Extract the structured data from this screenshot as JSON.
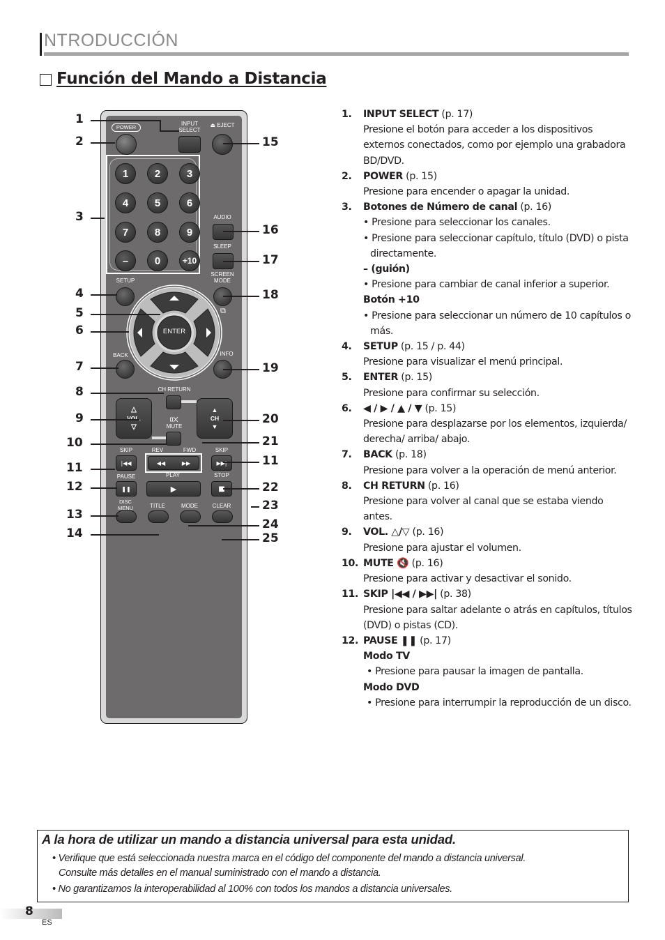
{
  "header": {
    "section": "NTRODUCCIÓN",
    "title": "Función del Mando a Distancia",
    "check_icon": "☑"
  },
  "remote": {
    "labels": {
      "power": "POWER",
      "input_select": "INPUT SELECT",
      "eject": "⏏ EJECT",
      "audio": "AUDIO",
      "sleep": "SLEEP",
      "screen_mode": "SCREEN MODE",
      "setup": "SETUP",
      "enter": "ENTER",
      "back": "BACK",
      "info": "INFO",
      "ch_return": "CH RETURN",
      "vol": "VOL.",
      "mute": "MUTE",
      "ch": "CH",
      "skip_prev": "SKIP",
      "rev": "REV",
      "fwd": "FWD",
      "skip_next": "SKIP",
      "pause": "PAUSE",
      "play": "PLAY",
      "stop": "STOP",
      "disc_menu": "DISC MENU",
      "title": "TITLE",
      "mode": "MODE",
      "clear": "CLEAR"
    },
    "numpad": [
      "1",
      "2",
      "3",
      "4",
      "5",
      "6",
      "7",
      "8",
      "9",
      "–",
      "0",
      "+10"
    ],
    "icons": {
      "up": "▲",
      "down": "▼",
      "left": "◀",
      "right": "▶",
      "vol_up": "△",
      "vol_down": "▽",
      "ch_up": "▲",
      "ch_down": "▼",
      "mute": "🔇",
      "skip_prev": "|◀◀",
      "rev": "◀◀",
      "fwd": "▶▶",
      "skip_next": "▶▶|",
      "pause": "❚❚",
      "play": "▶",
      "stop": "■",
      "screen_mode": "⧉"
    },
    "callouts_left": [
      "1",
      "2",
      "3",
      "4",
      "5",
      "6",
      "7",
      "8",
      "9",
      "10",
      "11",
      "12",
      "13",
      "14"
    ],
    "callouts_right": [
      "15",
      "16",
      "17",
      "18",
      "19",
      "20",
      "21",
      "11",
      "22",
      "23",
      "24",
      "25"
    ]
  },
  "items": [
    {
      "num": "1.",
      "name": "INPUT SELECT",
      "ref": " (p. 17)",
      "text": "Presione el botón para acceder a los dispositivos externos conectados, como por ejemplo una grabadora BD/DVD."
    },
    {
      "num": "2.",
      "name": "POWER",
      "ref": " (p. 15)",
      "text": "Presione para encender o apagar la unidad."
    },
    {
      "num": "3.",
      "name": "Botones de Número de canal",
      "ref": " (p. 16)",
      "bullets": [
        "• Presione para seleccionar los canales.",
        "• Presione para seleccionar capítulo, título (DVD) o pista directamente."
      ],
      "sub1": "– (guión)",
      "sub1_bullets": [
        "• Presione para cambiar de canal inferior a superior."
      ],
      "sub2": "Botón +10",
      "sub2_bullets": [
        "• Presione para seleccionar un número de 10 capítulos o más."
      ]
    },
    {
      "num": "4.",
      "name": "SETUP",
      "ref": " (p. 15 / p. 44)",
      "text": "Presione para visualizar el menú principal."
    },
    {
      "num": "5.",
      "name": "ENTER",
      "ref": " (p. 15)",
      "text": "Presione para confirmar su selección."
    },
    {
      "num": "6.",
      "name": "◀ / ▶ / ▲ / ▼",
      "ref": " (p. 15)",
      "text": "Presione para desplazarse por los elementos, izquierda/ derecha/ arriba/ abajo."
    },
    {
      "num": "7.",
      "name": "BACK",
      "ref": " (p. 18)",
      "text": "Presione para volver a la operación de menú anterior."
    },
    {
      "num": "8.",
      "name": "CH RETURN",
      "ref": " (p. 16)",
      "text": "Presione para volver al canal que se estaba viendo antes."
    },
    {
      "num": "9.",
      "name": "VOL. △/▽",
      "ref": " (p. 16)",
      "text": "Presione para ajustar el volumen."
    },
    {
      "num": "10.",
      "name": "MUTE 🔇",
      "ref": " (p. 16)",
      "text": "Presione para activar y desactivar el sonido."
    },
    {
      "num": "11.",
      "name": "SKIP |◀◀ / ▶▶|",
      "ref": " (p. 38)",
      "text": "Presione para saltar adelante o atrás en capítulos, títulos (DVD) o pistas (CD)."
    },
    {
      "num": "12.",
      "name": "PAUSE ❚❚",
      "ref": " (p. 17)",
      "sub1": "Modo TV",
      "sub1_bullets": [
        "• Presione para pausar la imagen de pantalla."
      ],
      "sub2": "Modo DVD",
      "sub2_bullets": [
        "• Presione para interrumpir la reproducción de un disco."
      ]
    }
  ],
  "note": {
    "title": "A la hora de utilizar un mando a distancia universal para esta unidad.",
    "bullets": [
      "• Verifique que está seleccionada nuestra marca en el código del componente del mando a distancia universal.",
      "Consulte más detalles en el manual suministrado con el mando a distancia.",
      "• No garantizamos la interoperabilidad al 100% con todos los mandos a distancia universales."
    ]
  },
  "footer": {
    "page": "8",
    "lang": "ES"
  }
}
